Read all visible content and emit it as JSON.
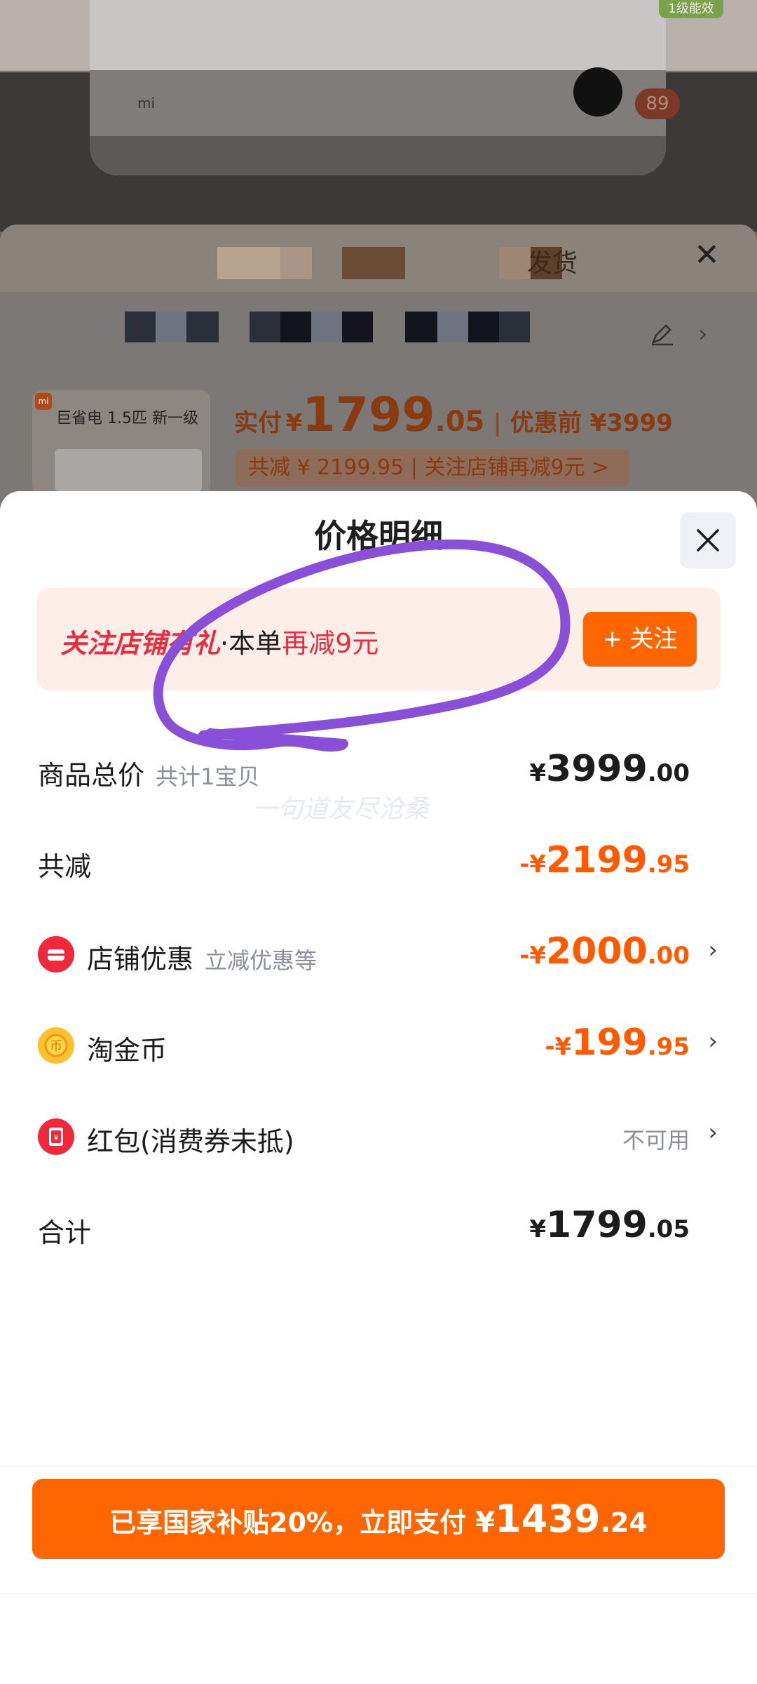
{
  "background": {
    "energy_badge": "1级能效",
    "cart_count": "89",
    "tab_text": "发货",
    "product": {
      "title": "巨省电 1.5匹 新一级",
      "price_label": "实付",
      "price_symbol": "¥",
      "price_int": "1799",
      "price_dec": ".05",
      "original_price": "优惠前 ¥3999",
      "discount_text": "共减 ¥ 2199.95 | 关注店铺再减9元 >"
    }
  },
  "sheet": {
    "title": "价格明细",
    "promo": {
      "part1": "关注店铺有礼",
      "part2": "·本单",
      "part3": "再减9元",
      "follow_label": "+ 关注"
    },
    "rows": [
      {
        "label": "商品总价",
        "sub": "共计1宝贝",
        "sym": "¥",
        "int": "3999",
        "dec": ".00"
      },
      {
        "label": "共减",
        "sym": "-¥",
        "int": "2199",
        "dec": ".95"
      },
      {
        "label": "店铺优惠",
        "sub": "立减优惠等",
        "sym": "-¥",
        "int": "2000",
        "dec": ".00"
      },
      {
        "label": "淘金币",
        "sym": "-¥",
        "int": "199",
        "dec": ".95"
      },
      {
        "label": "红包(消费券未抵)",
        "value": "不可用"
      },
      {
        "label": "合计",
        "sym": "¥",
        "int": "1799",
        "dec": ".05"
      }
    ],
    "watermark": "一句道友尽沧桑",
    "pay": {
      "text": "已享国家补贴20%，立即支付 ",
      "sym": "¥",
      "int": "1439",
      "dec": ".24"
    }
  },
  "colors": {
    "accent": "#ff6600",
    "discount_red": "#e92c40",
    "annotation_purple": "#8a4fd8"
  }
}
